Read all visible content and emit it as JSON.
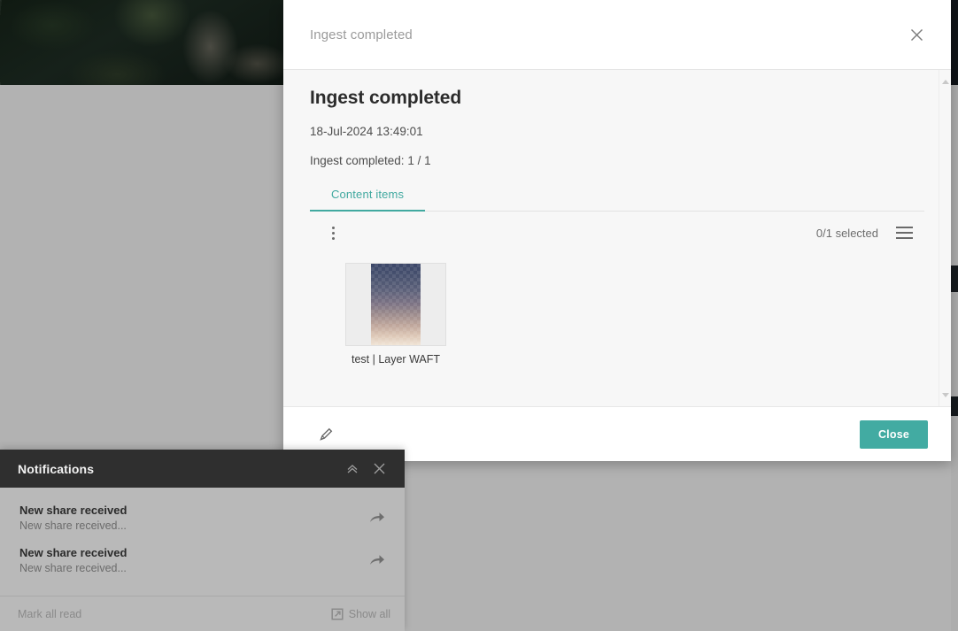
{
  "background": {
    "photo_alt": "dark-mountain-forest-photo"
  },
  "modal": {
    "header": {
      "title": "Ingest completed",
      "close_icon": "close-icon"
    },
    "body": {
      "title": "Ingest completed",
      "timestamp": "18-Jul-2024 13:49:01",
      "summary": "Ingest completed: 1 / 1",
      "tabs": [
        {
          "label": "Content items",
          "active": true
        }
      ],
      "toolbar": {
        "kebab_icon": "more-vertical-icon",
        "selected_count": "0/1 selected",
        "list_view_icon": "hamburger-icon"
      },
      "items": [
        {
          "label": "test | Layer WAFT",
          "thumbnail": "gradient-lattice-image"
        }
      ],
      "scrollbar": {
        "up_icon": "triangle-up-icon",
        "down_icon": "triangle-down-icon"
      }
    },
    "footer": {
      "edit_icon": "pencil-icon",
      "close_label": "Close"
    }
  },
  "notifications": {
    "title": "Notifications",
    "collapse_icon": "chevron-double-up-icon",
    "close_icon": "close-icon",
    "items": [
      {
        "title": "New share received",
        "subtitle": "New share received...",
        "action_icon": "share-forward-icon"
      },
      {
        "title": "New share received",
        "subtitle": "New share received...",
        "action_icon": "share-forward-icon"
      }
    ],
    "footer": {
      "mark_all_read": "Mark all read",
      "show_all": "Show all",
      "show_all_icon": "external-link-icon"
    }
  },
  "colors": {
    "accent_teal": "#42aba2",
    "modal_body_bg": "#f7f7f7",
    "notif_header_bg": "#2f2f2f",
    "page_bg": "#b2b2b2"
  }
}
